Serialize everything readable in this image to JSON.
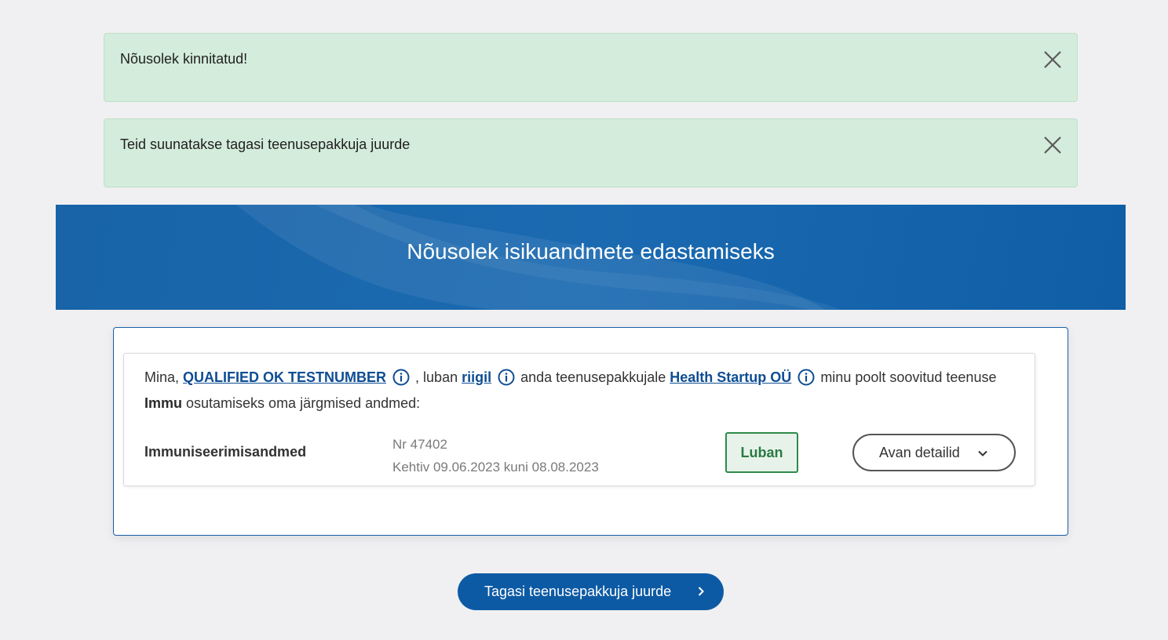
{
  "alerts": [
    {
      "text": "Nõusolek kinnitatud!"
    },
    {
      "text": "Teid suunatakse tagasi teenusepakkuja juurde"
    }
  ],
  "banner": {
    "title": "Nõusolek isikuandmete edastamiseks"
  },
  "consent": {
    "prefix": "Mina, ",
    "person": "QUALIFIED OK TESTNUMBER",
    "text_1": " , luban ",
    "recipient": "riigil",
    "text_2": " anda teenusepakkujale ",
    "provider": "Health Startup OÜ",
    "text_3": " minu poolt soovitud teenuse ",
    "service": "Immu",
    "text_4": " osutamiseks oma järgmised andmed:"
  },
  "data_item": {
    "name": "Immuniseerimisandmed",
    "number": "Nr 47402",
    "validity": "Kehtiv 09.06.2023 kuni 08.08.2023",
    "allow_label": "Luban",
    "details_label": "Avan detailid"
  },
  "back_button": {
    "label": "Tagasi teenusepakkuja juurde"
  },
  "colors": {
    "alert_bg": "#d4ecdb",
    "brand_blue": "#0d5aa4",
    "allow_green": "#2e8a4b"
  }
}
